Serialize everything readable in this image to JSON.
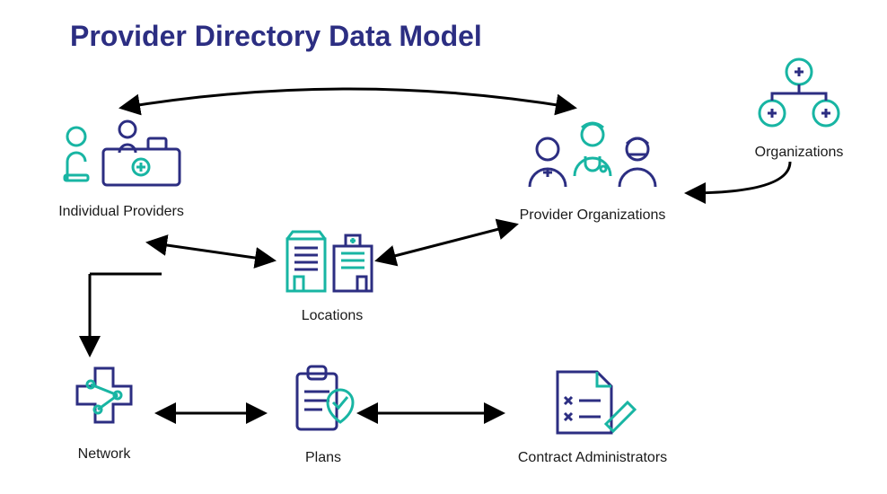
{
  "title": "Provider Directory Data Model",
  "nodes": {
    "individual_providers": {
      "label": "Individual Providers"
    },
    "provider_organizations": {
      "label": "Provider Organizations"
    },
    "organizations": {
      "label": "Organizations"
    },
    "locations": {
      "label": "Locations"
    },
    "network": {
      "label": "Network"
    },
    "plans": {
      "label": "Plans"
    },
    "contract_admins": {
      "label": "Contract Administrators"
    }
  },
  "colors": {
    "purple": "#2c2e82",
    "teal": "#18b5a3",
    "arrow": "#000000"
  },
  "relationships": [
    [
      "individual_providers",
      "provider_organizations",
      "bidirectional"
    ],
    [
      "individual_providers",
      "locations",
      "bidirectional"
    ],
    [
      "locations",
      "provider_organizations",
      "bidirectional"
    ],
    [
      "individual_providers",
      "network",
      "unidirectional"
    ],
    [
      "network",
      "plans",
      "bidirectional"
    ],
    [
      "plans",
      "contract_admins",
      "bidirectional"
    ],
    [
      "organizations",
      "provider_organizations",
      "unidirectional"
    ]
  ]
}
